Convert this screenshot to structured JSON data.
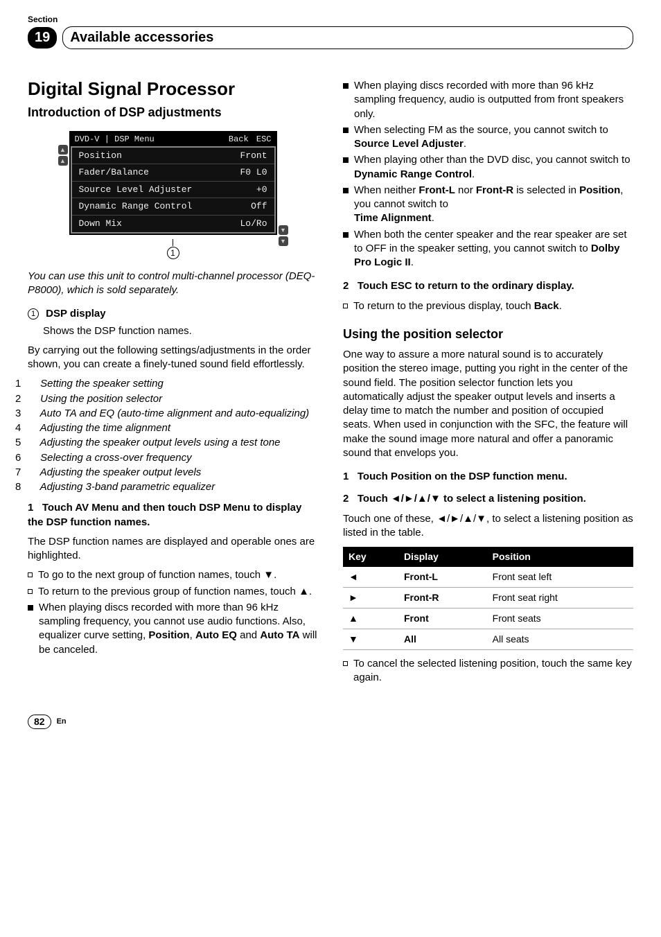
{
  "header": {
    "section_label": "Section",
    "section_number": "19",
    "section_title": "Available accessories"
  },
  "left": {
    "main_title": "Digital Signal Processor",
    "sub_title": "Introduction of DSP adjustments",
    "menu": {
      "source": "DVD-V",
      "title": "DSP Menu",
      "back": "Back",
      "esc": "ESC",
      "rows": [
        {
          "label": "Position",
          "value": "Front"
        },
        {
          "label": "Fader/Balance",
          "value": "F0 L0"
        },
        {
          "label": "Source Level Adjuster",
          "value": "+0"
        },
        {
          "label": "Dynamic Range Control",
          "value": "Off"
        },
        {
          "label": "Down Mix",
          "value": "Lo/Ro"
        }
      ]
    },
    "callout": "1",
    "italic_intro": "You can use this unit to control multi-channel processor (DEQ-P8000), which is sold separately.",
    "dsp_display_label": "DSP display",
    "dsp_display_desc": "Shows the DSP function names.",
    "carry_out_para": "By carrying out the following settings/adjustments in the order shown, you can create a finely-tuned sound field effortlessly.",
    "steps": [
      "Setting the speaker setting",
      "Using the position selector",
      "Auto TA and EQ (auto-time alignment and auto-equalizing)",
      "Adjusting the time alignment",
      "Adjusting the speaker output levels using a test tone",
      "Selecting a cross-over frequency",
      "Adjusting the speaker output levels",
      "Adjusting 3-band parametric equalizer"
    ],
    "step1_heading_num": "1",
    "step1_heading": "Touch AV Menu and then touch DSP Menu to display the DSP function names.",
    "step1_body": "The DSP function names are displayed and operable ones are highlighted.",
    "bullets1": [
      {
        "text_a": "To go to the next group of function names, touch ",
        "icon": "▼",
        "text_b": "."
      },
      {
        "text_a": "To return to the previous group of function names, touch ",
        "icon": "▲",
        "text_b": "."
      }
    ],
    "solid_bullet1_a": "When playing discs recorded with more than 96 kHz sampling frequency, you cannot use audio functions. Also, equalizer curve setting, ",
    "solid_bullet1_b": "Position",
    "solid_bullet1_c": ", ",
    "solid_bullet1_d": "Auto EQ",
    "solid_bullet1_e": " and ",
    "solid_bullet1_f": "Auto TA",
    "solid_bullet1_g": " will be canceled."
  },
  "right": {
    "sb1": "When playing discs recorded with more than 96 kHz sampling frequency, audio is outputted from front speakers only.",
    "sb2_a": "When selecting FM as the source, you cannot switch to ",
    "sb2_b": "Source Level Adjuster",
    "sb2_c": ".",
    "sb3_a": "When playing other than the DVD disc, you cannot switch to ",
    "sb3_b": "Dynamic Range Control",
    "sb3_c": ".",
    "sb4_a": "When neither ",
    "sb4_b": "Front-L",
    "sb4_c": " nor ",
    "sb4_d": "Front-R",
    "sb4_e": " is selected in ",
    "sb4_f": "Position",
    "sb4_g": ", you cannot switch to",
    "sb4_h": "Time Alignment",
    "sb4_i": ".",
    "sb5_a": "When both the center speaker and the rear speaker are set to OFF in the speaker setting, you cannot switch to ",
    "sb5_b": "Dolby Pro Logic II",
    "sb5_c": ".",
    "esc_num": "2",
    "esc_heading": "Touch ESC to return to the ordinary display.",
    "esc_bullet_a": "To return to the previous display, touch ",
    "esc_bullet_b": "Back",
    "esc_bullet_c": ".",
    "pos_heading": "Using the position selector",
    "pos_para": "One way to assure a more natural sound is to accurately position the stereo image, putting you right in the center of the sound field. The position selector function lets you automatically adjust the speaker output levels and inserts a delay time to match the number and position of occupied seats. When used in conjunction with the SFC, the feature will make the sound image more natural and offer a panoramic sound that envelops you.",
    "pos_step1_num": "1",
    "pos_step1": "Touch Position on the DSP function menu.",
    "pos_step2_num": "2",
    "pos_step2_a": "Touch ",
    "pos_step2_b": "◄/►/▲/▼",
    "pos_step2_c": " to select a listening position.",
    "pos_step2_body_a": "Touch one of these, ",
    "pos_step2_body_b": "◄/►/▲/▼",
    "pos_step2_body_c": ", to select a listening position as listed in the table.",
    "table": {
      "headers": [
        "Key",
        "Display",
        "Position"
      ],
      "rows": [
        {
          "key": "◄",
          "display": "Front-L",
          "position": "Front seat left"
        },
        {
          "key": "►",
          "display": "Front-R",
          "position": "Front seat right"
        },
        {
          "key": "▲",
          "display": "Front",
          "position": "Front seats"
        },
        {
          "key": "▼",
          "display": "All",
          "position": "All seats"
        }
      ]
    },
    "cancel_bullet": "To cancel the selected listening position, touch the same key again."
  },
  "footer": {
    "page": "82",
    "lang": "En"
  }
}
